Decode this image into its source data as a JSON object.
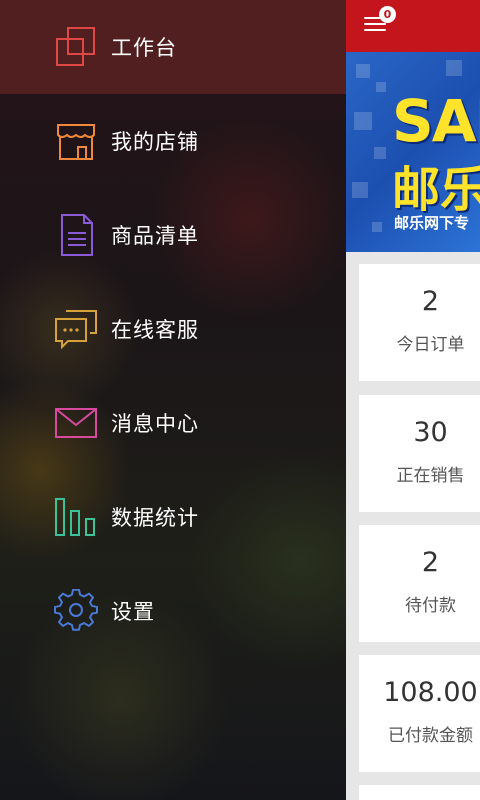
{
  "drawer": {
    "items": [
      {
        "label": "工作台",
        "icon": "workbench-icon",
        "color": "#e04848"
      },
      {
        "label": "我的店铺",
        "icon": "store-icon",
        "color": "#f08a3a"
      },
      {
        "label": "商品清单",
        "icon": "document-list-icon",
        "color": "#8a5ad8"
      },
      {
        "label": "在线客服",
        "icon": "chat-bubbles-icon",
        "color": "#d8a23a"
      },
      {
        "label": "消息中心",
        "icon": "envelope-icon",
        "color": "#d84aa0"
      },
      {
        "label": "数据统计",
        "icon": "bar-chart-icon",
        "color": "#3ac29a"
      },
      {
        "label": "设置",
        "icon": "gear-icon",
        "color": "#4a7ad8"
      }
    ]
  },
  "header": {
    "menu_icon": "hamburger-icon",
    "badge_count": "0",
    "accent_color": "#c4151c"
  },
  "banner": {
    "line1": "SAL",
    "line2": "邮乐",
    "line3": "邮乐网下专"
  },
  "stats": [
    {
      "value": "2",
      "label": "今日订单"
    },
    {
      "value": "30",
      "label": "正在销售"
    },
    {
      "value": "2",
      "label": "待付款"
    },
    {
      "value": "108.00",
      "label": "已付款金额"
    }
  ]
}
